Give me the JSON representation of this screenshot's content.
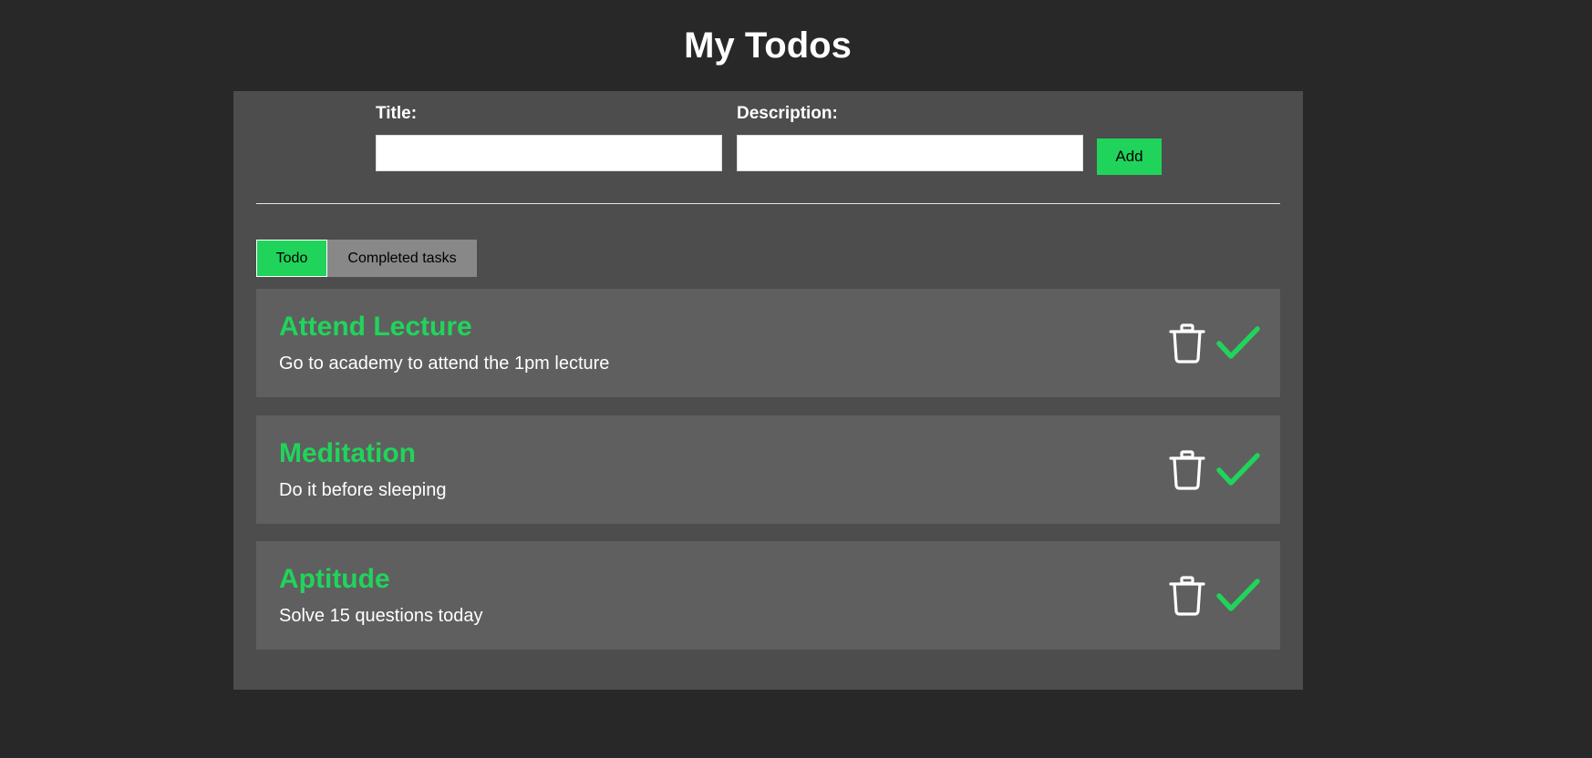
{
  "header": {
    "title": "My Todos"
  },
  "form": {
    "title_label": "Title:",
    "title_value": "",
    "description_label": "Description:",
    "description_value": "",
    "add_label": "Add"
  },
  "tabs": [
    {
      "label": "Todo",
      "active": true
    },
    {
      "label": "Completed tasks",
      "active": false
    }
  ],
  "todos": [
    {
      "title": "Attend Lecture",
      "description": "Go to academy to attend the 1pm lecture"
    },
    {
      "title": "Meditation",
      "description": "Do it before sleeping"
    },
    {
      "title": "Aptitude",
      "description": "Solve 15 questions today"
    }
  ],
  "icons": {
    "delete": "trash-icon",
    "complete": "check-icon"
  },
  "colors": {
    "background": "#282828",
    "panel": "#4d4d4d",
    "card": "#5f5f5f",
    "accent": "#20d45b",
    "inactive_tab": "#888888"
  }
}
